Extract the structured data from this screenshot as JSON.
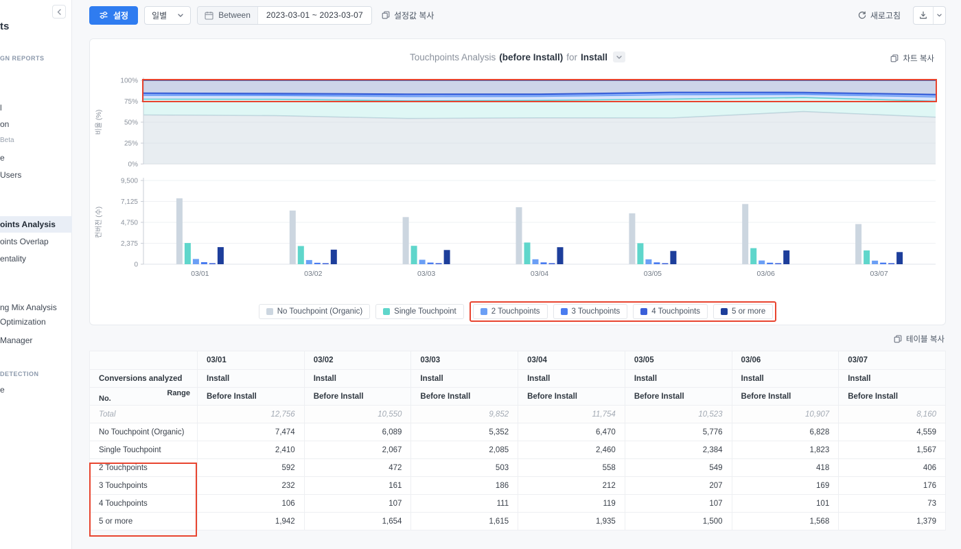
{
  "annotations": {
    "color": "#e8442f"
  },
  "sidebar": {
    "title": "ts",
    "section1": "GN REPORTS",
    "section2": "DETECTION",
    "group1": [
      "l",
      "on",
      "Beta",
      "e",
      "Users"
    ],
    "group2": [
      "oints Analysis",
      "oints Overlap",
      "entality"
    ],
    "group3": [
      "ng Mix Analysis",
      "Optimization",
      "Manager"
    ],
    "group4": [
      "e"
    ]
  },
  "toolbar": {
    "settings_label": "설정",
    "granularity": "일별",
    "between_label": "Between",
    "date_range": "2023-03-01 ~ 2023-03-07",
    "copy_settings": "설정값 복사",
    "refresh_label": "새로고침"
  },
  "chart_card": {
    "title_gray1": "Touchpoints Analysis",
    "title_bold1": "(before Install)",
    "title_gray2": "for",
    "title_bold2": "Install",
    "copy_label": "차트 복사"
  },
  "chart_data": [
    {
      "type": "area",
      "stacked_percent": true,
      "title": "Touchpoints Analysis (before Install) for Install",
      "x": [
        "03/01",
        "03/02",
        "03/03",
        "03/04",
        "03/05",
        "03/06",
        "03/07"
      ],
      "ylabel": "비율 (%)",
      "ylim": [
        0,
        100
      ],
      "ytick_values": [
        0,
        25,
        50,
        75,
        100
      ],
      "ytick_labels": [
        "0%",
        "25%",
        "50%",
        "75%",
        "100%"
      ],
      "legend_position": "bottom",
      "series": [
        {
          "name": "No Touchpoint (Organic)",
          "color": "#ccd6e0",
          "values": [
            58.59,
            57.72,
            54.32,
            55.05,
            54.89,
            62.6,
            55.87
          ]
        },
        {
          "name": "Single Touchpoint",
          "color": "#5fd6cb",
          "values": [
            18.89,
            19.59,
            21.16,
            20.93,
            22.66,
            16.71,
            19.2
          ]
        },
        {
          "name": "2 Touchpoints",
          "color": "#6b9ff5",
          "values": [
            4.64,
            4.47,
            5.11,
            4.75,
            5.22,
            3.83,
            4.98
          ]
        },
        {
          "name": "3 Touchpoints",
          "color": "#4a7cf0",
          "values": [
            1.82,
            1.53,
            1.89,
            1.8,
            1.97,
            1.55,
            2.16
          ]
        },
        {
          "name": "4 Touchpoints",
          "color": "#3a5fd9",
          "values": [
            0.83,
            1.01,
            1.13,
            1.01,
            1.02,
            0.93,
            0.89
          ]
        },
        {
          "name": "5 or more",
          "color": "#1d3e9b",
          "values": [
            15.22,
            15.68,
            16.39,
            16.46,
            14.26,
            14.38,
            16.9
          ]
        }
      ]
    },
    {
      "type": "bar",
      "x": [
        "03/01",
        "03/02",
        "03/03",
        "03/04",
        "03/05",
        "03/06",
        "03/07"
      ],
      "ylabel": "컨버전 (수)",
      "ylim": [
        0,
        9500
      ],
      "ytick_values": [
        0,
        2375,
        4750,
        7125,
        9500
      ],
      "ytick_labels": [
        "0",
        "2,375",
        "4,750",
        "7,125",
        "9,500"
      ],
      "series": [
        {
          "name": "No Touchpoint (Organic)",
          "color": "#ccd6e0",
          "values": [
            7474,
            6089,
            5352,
            6470,
            5776,
            6828,
            4559
          ]
        },
        {
          "name": "Single Touchpoint",
          "color": "#5fd6cb",
          "values": [
            2410,
            2067,
            2085,
            2460,
            2384,
            1823,
            1567
          ]
        },
        {
          "name": "2 Touchpoints",
          "color": "#6b9ff5",
          "values": [
            592,
            472,
            503,
            558,
            549,
            418,
            406
          ]
        },
        {
          "name": "3 Touchpoints",
          "color": "#4a7cf0",
          "values": [
            232,
            161,
            186,
            212,
            207,
            169,
            176
          ]
        },
        {
          "name": "4 Touchpoints",
          "color": "#3a5fd9",
          "values": [
            106,
            107,
            111,
            119,
            107,
            101,
            73
          ]
        },
        {
          "name": "5 or more",
          "color": "#1d3e9b",
          "values": [
            1942,
            1654,
            1615,
            1935,
            1500,
            1568,
            1379
          ]
        }
      ]
    }
  ],
  "table": {
    "copy_label": "테이블 복사",
    "columns": [
      "03/01",
      "03/02",
      "03/03",
      "03/04",
      "03/05",
      "03/06",
      "03/07"
    ],
    "conversions_label": "Conversions analyzed",
    "conversions_values": [
      "Install",
      "Install",
      "Install",
      "Install",
      "Install",
      "Install",
      "Install"
    ],
    "corner": {
      "no": "No.",
      "range": "Range"
    },
    "range_values": [
      "Before Install",
      "Before Install",
      "Before Install",
      "Before Install",
      "Before Install",
      "Before Install",
      "Before Install"
    ],
    "rows": [
      {
        "label": "Total",
        "muted": true,
        "values": [
          "12,756",
          "10,550",
          "9,852",
          "11,754",
          "10,523",
          "10,907",
          "8,160"
        ]
      },
      {
        "label": "No Touchpoint (Organic)",
        "values": [
          "7,474",
          "6,089",
          "5,352",
          "6,470",
          "5,776",
          "6,828",
          "4,559"
        ]
      },
      {
        "label": "Single Touchpoint",
        "values": [
          "2,410",
          "2,067",
          "2,085",
          "2,460",
          "2,384",
          "1,823",
          "1,567"
        ]
      },
      {
        "label": "2 Touchpoints",
        "values": [
          "592",
          "472",
          "503",
          "558",
          "549",
          "418",
          "406"
        ]
      },
      {
        "label": "3 Touchpoints",
        "values": [
          "232",
          "161",
          "186",
          "212",
          "207",
          "169",
          "176"
        ]
      },
      {
        "label": "4 Touchpoints",
        "values": [
          "106",
          "107",
          "111",
          "119",
          "107",
          "101",
          "73"
        ]
      },
      {
        "label": "5 or more",
        "values": [
          "1,942",
          "1,654",
          "1,615",
          "1,935",
          "1,500",
          "1,568",
          "1,379"
        ]
      }
    ]
  }
}
